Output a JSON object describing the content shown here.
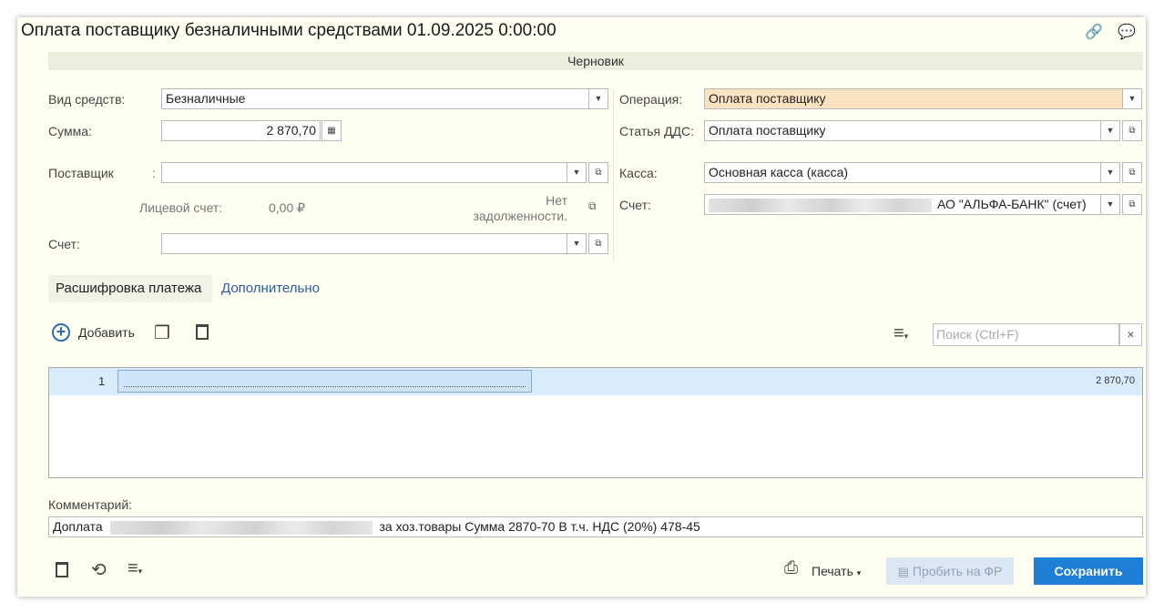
{
  "window": {
    "title": "Оплата поставщику безналичными средствами 01.09.2025 0:00:00",
    "link_icon": "🔗",
    "comment_icon": "💬"
  },
  "status": "Черновик",
  "left": {
    "vid_label": "Вид средств:",
    "vid_value": "Безналичные",
    "summa_label": "Сумма:",
    "summa_value": "2 870,70",
    "calc_icon": "▦",
    "supplier_label": "Поставщик",
    "supplier_colon": ":",
    "supplier_value": "",
    "account_face_label": "Лицевой счет:",
    "account_face_value": "0,00 ₽",
    "no_debt_line1": "Нет",
    "no_debt_line2": "задолженности.",
    "schet_label": "Счет:",
    "schet_value": ""
  },
  "right": {
    "operation_label": "Операция:",
    "operation_value": "Оплата поставщику",
    "dds_label": "Статья ДДС:",
    "dds_value": "Оплата поставщику",
    "kassa_label": "Касса:",
    "kassa_value": "Основная касса (касса)",
    "schet_label": "Счет:",
    "schet_value": "АО \"АЛЬФА-БАНК\" (счет)"
  },
  "tabs": [
    {
      "label": "Расшифровка платежа"
    },
    {
      "label": "Дополнительно"
    }
  ],
  "toolbar": {
    "add_label": "Добавить",
    "search_placeholder": "Поиск (Ctrl+F)",
    "search_clear": "×"
  },
  "table": {
    "rows": [
      {
        "num": "1",
        "amount": "2 870,70"
      }
    ]
  },
  "comment": {
    "label": "Комментарий:",
    "prefix": "Доплата",
    "suffix": "за хоз.товары Сумма 2870-70 В т.ч. НДС  (20%) 478-45"
  },
  "footer": {
    "print_label": "Печать",
    "fr_label": "Пробить на ФР",
    "save_label": "Сохранить"
  },
  "colors": {
    "accent": "#1e7fd6",
    "operation_bg": "#fbe3c1",
    "link": "#2b5ea3"
  }
}
